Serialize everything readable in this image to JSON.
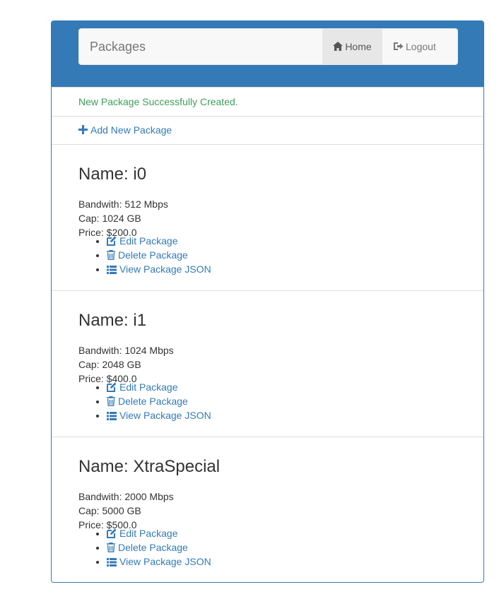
{
  "navbar": {
    "brand": "Packages",
    "home_label": "Home",
    "logout_label": "Logout"
  },
  "alert": {
    "message": "New Package Successfully Created."
  },
  "add_new_label": "Add New Package",
  "packages": [
    {
      "name": "Name: i0",
      "bandwidth": "Bandwith: 512 Mbps",
      "cap": "Cap: 1024 GB",
      "price": "Price: $200.0",
      "actions": [
        "Edit Package",
        "Delete Package",
        "View Package JSON"
      ]
    },
    {
      "name": "Name: i1",
      "bandwidth": "Bandwith: 1024 Mbps",
      "cap": "Cap: 2048 GB",
      "price": "Price: $400.0",
      "actions": [
        "Edit Package",
        "Delete Package",
        "View Package JSON"
      ]
    },
    {
      "name": "Name: XtraSpecial",
      "bandwidth": "Bandwith: 2000 Mbps",
      "cap": "Cap: 5000 GB",
      "price": "Price: $500.0",
      "actions": [
        "Edit Package",
        "Delete Package",
        "View Package JSON"
      ]
    }
  ],
  "icons": {
    "home": "home-icon",
    "logout": "logout-icon",
    "add": "plus-icon",
    "edit": "edit-icon",
    "delete": "trash-icon",
    "view": "list-icon"
  },
  "colors": {
    "primary": "#337ab7",
    "success": "#3c9f5a",
    "navbar_bg": "#f8f8f8",
    "active_bg": "#e7e7e7"
  }
}
